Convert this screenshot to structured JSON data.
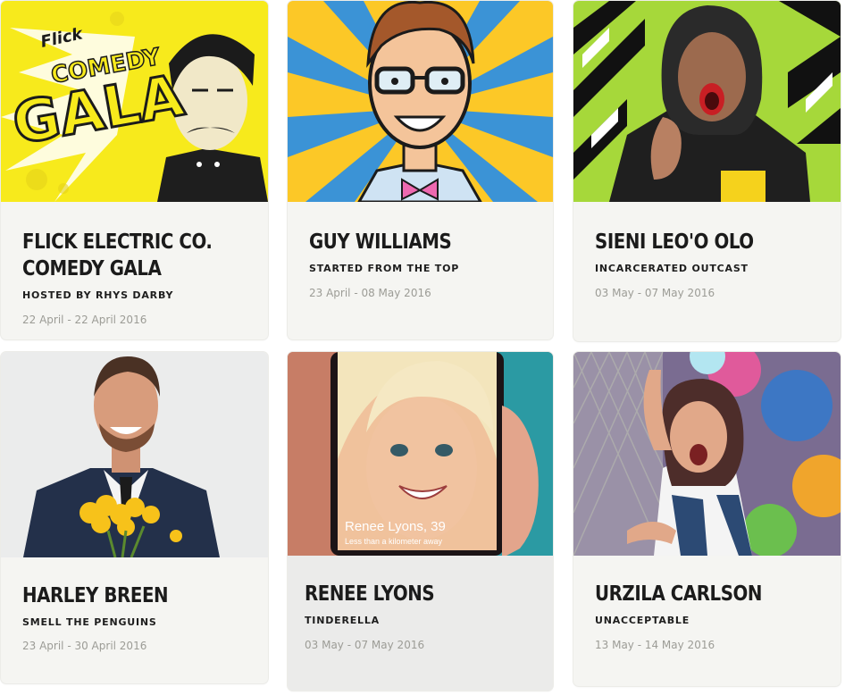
{
  "shows": [
    {
      "title_line1": "Flick Electric Co.",
      "title_line2": "Comedy Gala",
      "subtitle": "Hosted by Rhys Darby",
      "dates": "22 April - 22 April 2016",
      "poster_text_brand": "Flick",
      "poster_text_comedy": "COMEDY",
      "poster_text_gala": "GALA"
    },
    {
      "title_line1": "Guy Williams",
      "subtitle": "Started from the top",
      "dates": "23 April - 08 May 2016"
    },
    {
      "title_line1": "Sieni Leo'o Olo",
      "subtitle": "Incarcerated Outcast",
      "dates": "03 May - 07 May 2016"
    },
    {
      "title_line1": "Harley Breen",
      "subtitle": "Smell the Penguins",
      "dates": "23 April - 30 April 2016"
    },
    {
      "title_line1": "Renee Lyons",
      "subtitle": "Tinderella",
      "dates": "03 May - 07 May 2016",
      "phone_name": "Renee Lyons, 39",
      "phone_distance": "Less than a kilometer away"
    },
    {
      "title_line1": "Urzila Carlson",
      "subtitle": "Unacceptable",
      "dates": "13 May - 14 May 2016"
    }
  ],
  "colors": {
    "card_bg": "#f5f5f2",
    "card_bg_hover": "#ebebea",
    "title": "#1b1b1b",
    "date": "#9c9c96",
    "gala_yellow": "#f7ea1c",
    "sunburst_blue": "#3b93d6",
    "sunburst_yellow": "#fcc827",
    "tribal_green": "#a6d83a"
  }
}
